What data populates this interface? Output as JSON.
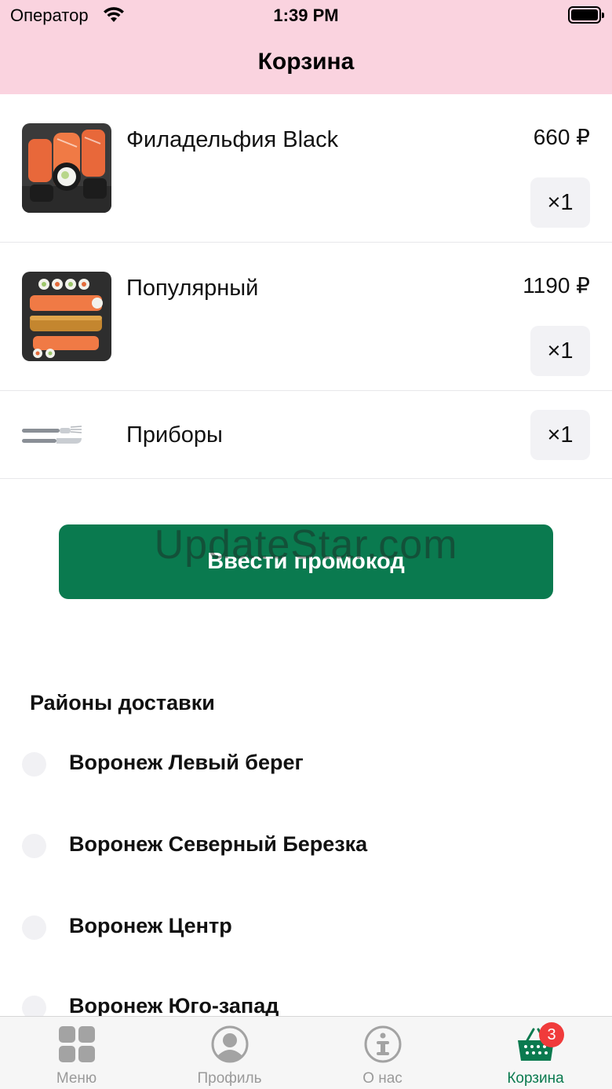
{
  "status_bar": {
    "carrier": "Оператор",
    "time": "1:39 PM"
  },
  "nav": {
    "title": "Корзина"
  },
  "cart_items": [
    {
      "name": "Филадельфия Black",
      "price": "660 ₽",
      "quantity": "×1",
      "image": "sushi-roll-image"
    },
    {
      "name": "Популярный",
      "price": "1190 ₽",
      "quantity": "×1",
      "image": "sushi-set-image"
    },
    {
      "name": "Приборы",
      "price": "",
      "quantity": "×1",
      "image": "cutlery-icon"
    }
  ],
  "promo_button": {
    "label": "Ввести промокод",
    "color": "#0a7a4f"
  },
  "watermark": "UpdateStar.com",
  "delivery": {
    "title": "Районы доставки",
    "districts": [
      {
        "label": "Воронеж Левый берег",
        "selected": false
      },
      {
        "label": "Воронеж Северный Березка",
        "selected": false
      },
      {
        "label": "Воронеж Центр",
        "selected": false
      },
      {
        "label": "Воронеж Юго-запад",
        "selected": false
      }
    ]
  },
  "tab_bar": {
    "tabs": [
      {
        "label": "Меню",
        "icon": "grid-icon",
        "active": false
      },
      {
        "label": "Профиль",
        "icon": "profile-icon",
        "active": false
      },
      {
        "label": "О нас",
        "icon": "info-icon",
        "active": false
      },
      {
        "label": "Корзина",
        "icon": "basket-icon",
        "active": true,
        "badge": "3"
      }
    ]
  },
  "colors": {
    "header_bg": "#fad3df",
    "accent": "#0a7a4f",
    "badge": "#f03b3b"
  }
}
